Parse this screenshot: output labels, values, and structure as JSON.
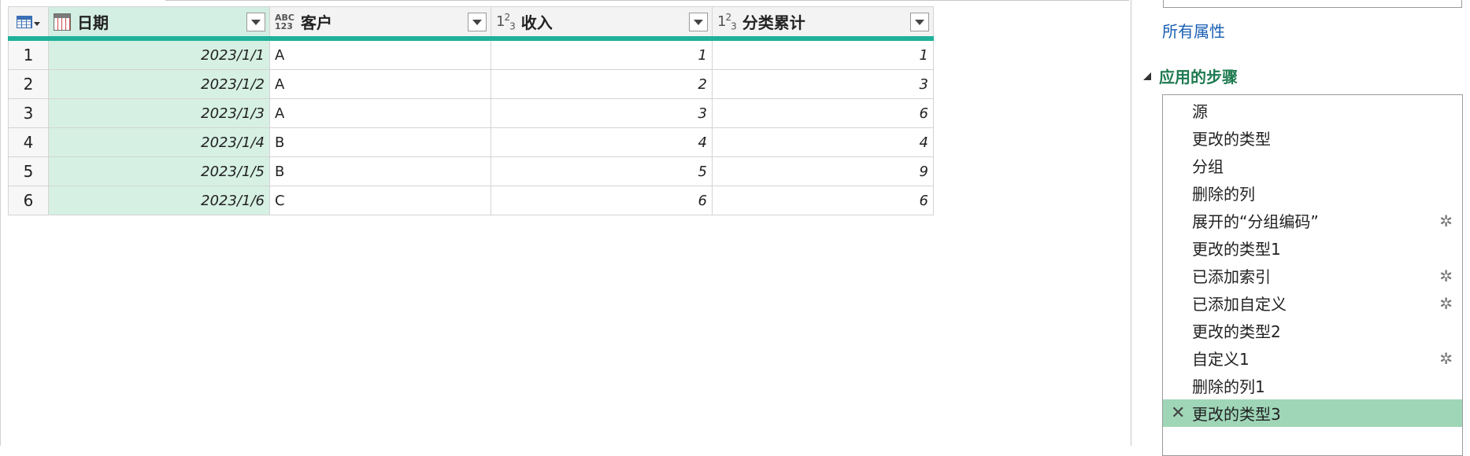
{
  "grid": {
    "columns": [
      {
        "name": "日期",
        "type": "date"
      },
      {
        "name": "客户",
        "type": "text"
      },
      {
        "name": "收入",
        "type": "number"
      },
      {
        "name": "分类累计",
        "type": "number"
      }
    ],
    "rows": [
      {
        "n": "1",
        "date": "2023/1/1",
        "cust": "A",
        "inc": "1",
        "cum": "1"
      },
      {
        "n": "2",
        "date": "2023/1/2",
        "cust": "A",
        "inc": "2",
        "cum": "3"
      },
      {
        "n": "3",
        "date": "2023/1/3",
        "cust": "A",
        "inc": "3",
        "cum": "6"
      },
      {
        "n": "4",
        "date": "2023/1/4",
        "cust": "B",
        "inc": "4",
        "cum": "4"
      },
      {
        "n": "5",
        "date": "2023/1/5",
        "cust": "B",
        "inc": "5",
        "cum": "9"
      },
      {
        "n": "6",
        "date": "2023/1/6",
        "cust": "C",
        "inc": "6",
        "cum": "6"
      }
    ],
    "header_accent": "#1fb19a",
    "selected_column_bg": "#d6f0e4"
  },
  "panel": {
    "all_properties_link": "所有属性",
    "steps_title": "应用的步骤",
    "steps": [
      {
        "label": "源",
        "gear": false
      },
      {
        "label": "更改的类型",
        "gear": false
      },
      {
        "label": "分组",
        "gear": false
      },
      {
        "label": "删除的列",
        "gear": false
      },
      {
        "label": "展开的“分组编码”",
        "gear": true
      },
      {
        "label": "更改的类型1",
        "gear": false
      },
      {
        "label": "已添加索引",
        "gear": true
      },
      {
        "label": "已添加自定义",
        "gear": true
      },
      {
        "label": "更改的类型2",
        "gear": false
      },
      {
        "label": "自定义1",
        "gear": true
      },
      {
        "label": "删除的列1",
        "gear": false
      },
      {
        "label": "更改的类型3",
        "gear": false,
        "active": true,
        "deletable": true
      }
    ],
    "active_step_color": "#9fd6b8",
    "link_color": "#1a5fb4"
  }
}
